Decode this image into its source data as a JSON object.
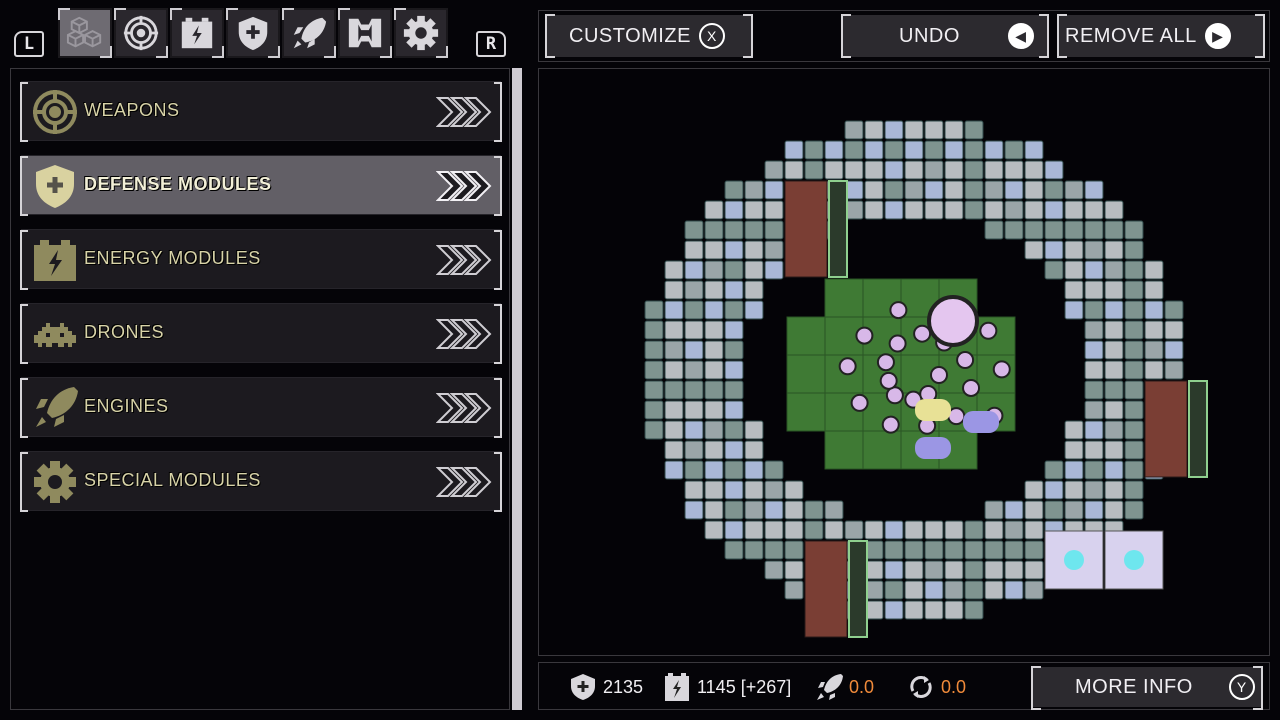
{
  "tabs": {
    "shoulder_left": "L",
    "shoulder_right": "R",
    "items": [
      {
        "icon": "modules-cubes-icon",
        "active": true
      },
      {
        "icon": "target-icon",
        "active": false
      },
      {
        "icon": "battery-icon",
        "active": false
      },
      {
        "icon": "shield-plus-icon",
        "active": false
      },
      {
        "icon": "rocket-icon",
        "active": false
      },
      {
        "icon": "ship-frame-icon",
        "active": false
      },
      {
        "icon": "gear-icon",
        "active": false
      }
    ]
  },
  "categories": [
    {
      "label": "WEAPONS",
      "icon": "target-icon",
      "selected": false
    },
    {
      "label": "DEFENSE MODULES",
      "icon": "shield-plus-icon",
      "selected": true
    },
    {
      "label": "ENERGY MODULES",
      "icon": "battery-icon",
      "selected": false
    },
    {
      "label": "DRONES",
      "icon": "invader-icon",
      "selected": false
    },
    {
      "label": "ENGINES",
      "icon": "rocket-icon",
      "selected": false
    },
    {
      "label": "SPECIAL MODULES",
      "icon": "gear-icon",
      "selected": false
    }
  ],
  "toolbar": {
    "customize_label": "CUSTOMIZE",
    "customize_key": "X",
    "undo_label": "UNDO",
    "remove_all_label": "REMOVE ALL"
  },
  "stats": {
    "defense": "2135",
    "energy": "1145 [+267]",
    "thrust": "0.0",
    "rotation": "0.0",
    "more_info_label": "MORE INFO",
    "more_info_key": "Y"
  },
  "colors": {
    "accent_olive": "#a8a06a",
    "stat_orange": "#f08a3a",
    "selected_row": "#625f66"
  }
}
